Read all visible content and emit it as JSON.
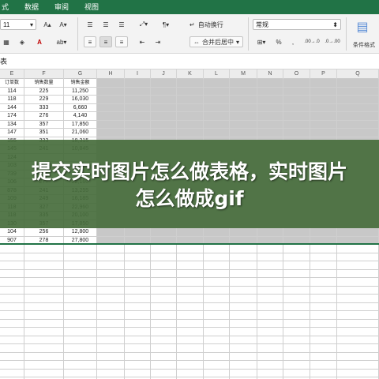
{
  "ribbon_tabs": [
    "式",
    "数据",
    "审阅",
    "视图"
  ],
  "ribbon": {
    "font_size": "11",
    "grow_font": "A▴",
    "shrink_font": "A▾",
    "wrap_text": "自动换行",
    "merge_center": "合并后居中",
    "number_format": "常规",
    "percent": "%",
    "comma": ",",
    "inc_decimal": ".00→.0",
    "dec_decimal": ".0→.00",
    "conditional_format": "条件格式"
  },
  "formula_bar": {
    "name_box": "表"
  },
  "columns": [
    "E",
    "F",
    "G",
    "H",
    "I",
    "J",
    "K",
    "L",
    "M",
    "N",
    "O",
    "P",
    "Q"
  ],
  "table": {
    "headers": [
      "订单数",
      "销售数量",
      "销售金额"
    ],
    "rows": [
      [
        "114",
        "225",
        "11,250"
      ],
      [
        "118",
        "229",
        "16,030"
      ],
      [
        "144",
        "333",
        "6,660"
      ],
      [
        "174",
        "276",
        "4,140"
      ],
      [
        "134",
        "357",
        "17,850"
      ],
      [
        "147",
        "351",
        "21,060"
      ],
      [
        "155",
        "333",
        "18,315"
      ],
      [
        "145",
        "241",
        "10,845"
      ],
      [
        "124",
        "",
        ""
      ],
      [
        "103",
        "",
        ""
      ],
      [
        "739",
        "",
        ""
      ],
      [
        "106",
        "277",
        "22,160"
      ],
      [
        "878",
        "241",
        "13,255"
      ],
      [
        "109",
        "249",
        "16,185"
      ],
      [
        "118",
        "327",
        "22,960"
      ],
      [
        "118",
        "335",
        "20,100"
      ],
      [
        "130",
        "357",
        "17,850"
      ],
      [
        "104",
        "256",
        "12,800"
      ],
      [
        "907",
        "278",
        "27,800"
      ]
    ]
  },
  "overlay": {
    "title": "提交实时图片怎么做表格，实时图片怎么做成gif"
  }
}
